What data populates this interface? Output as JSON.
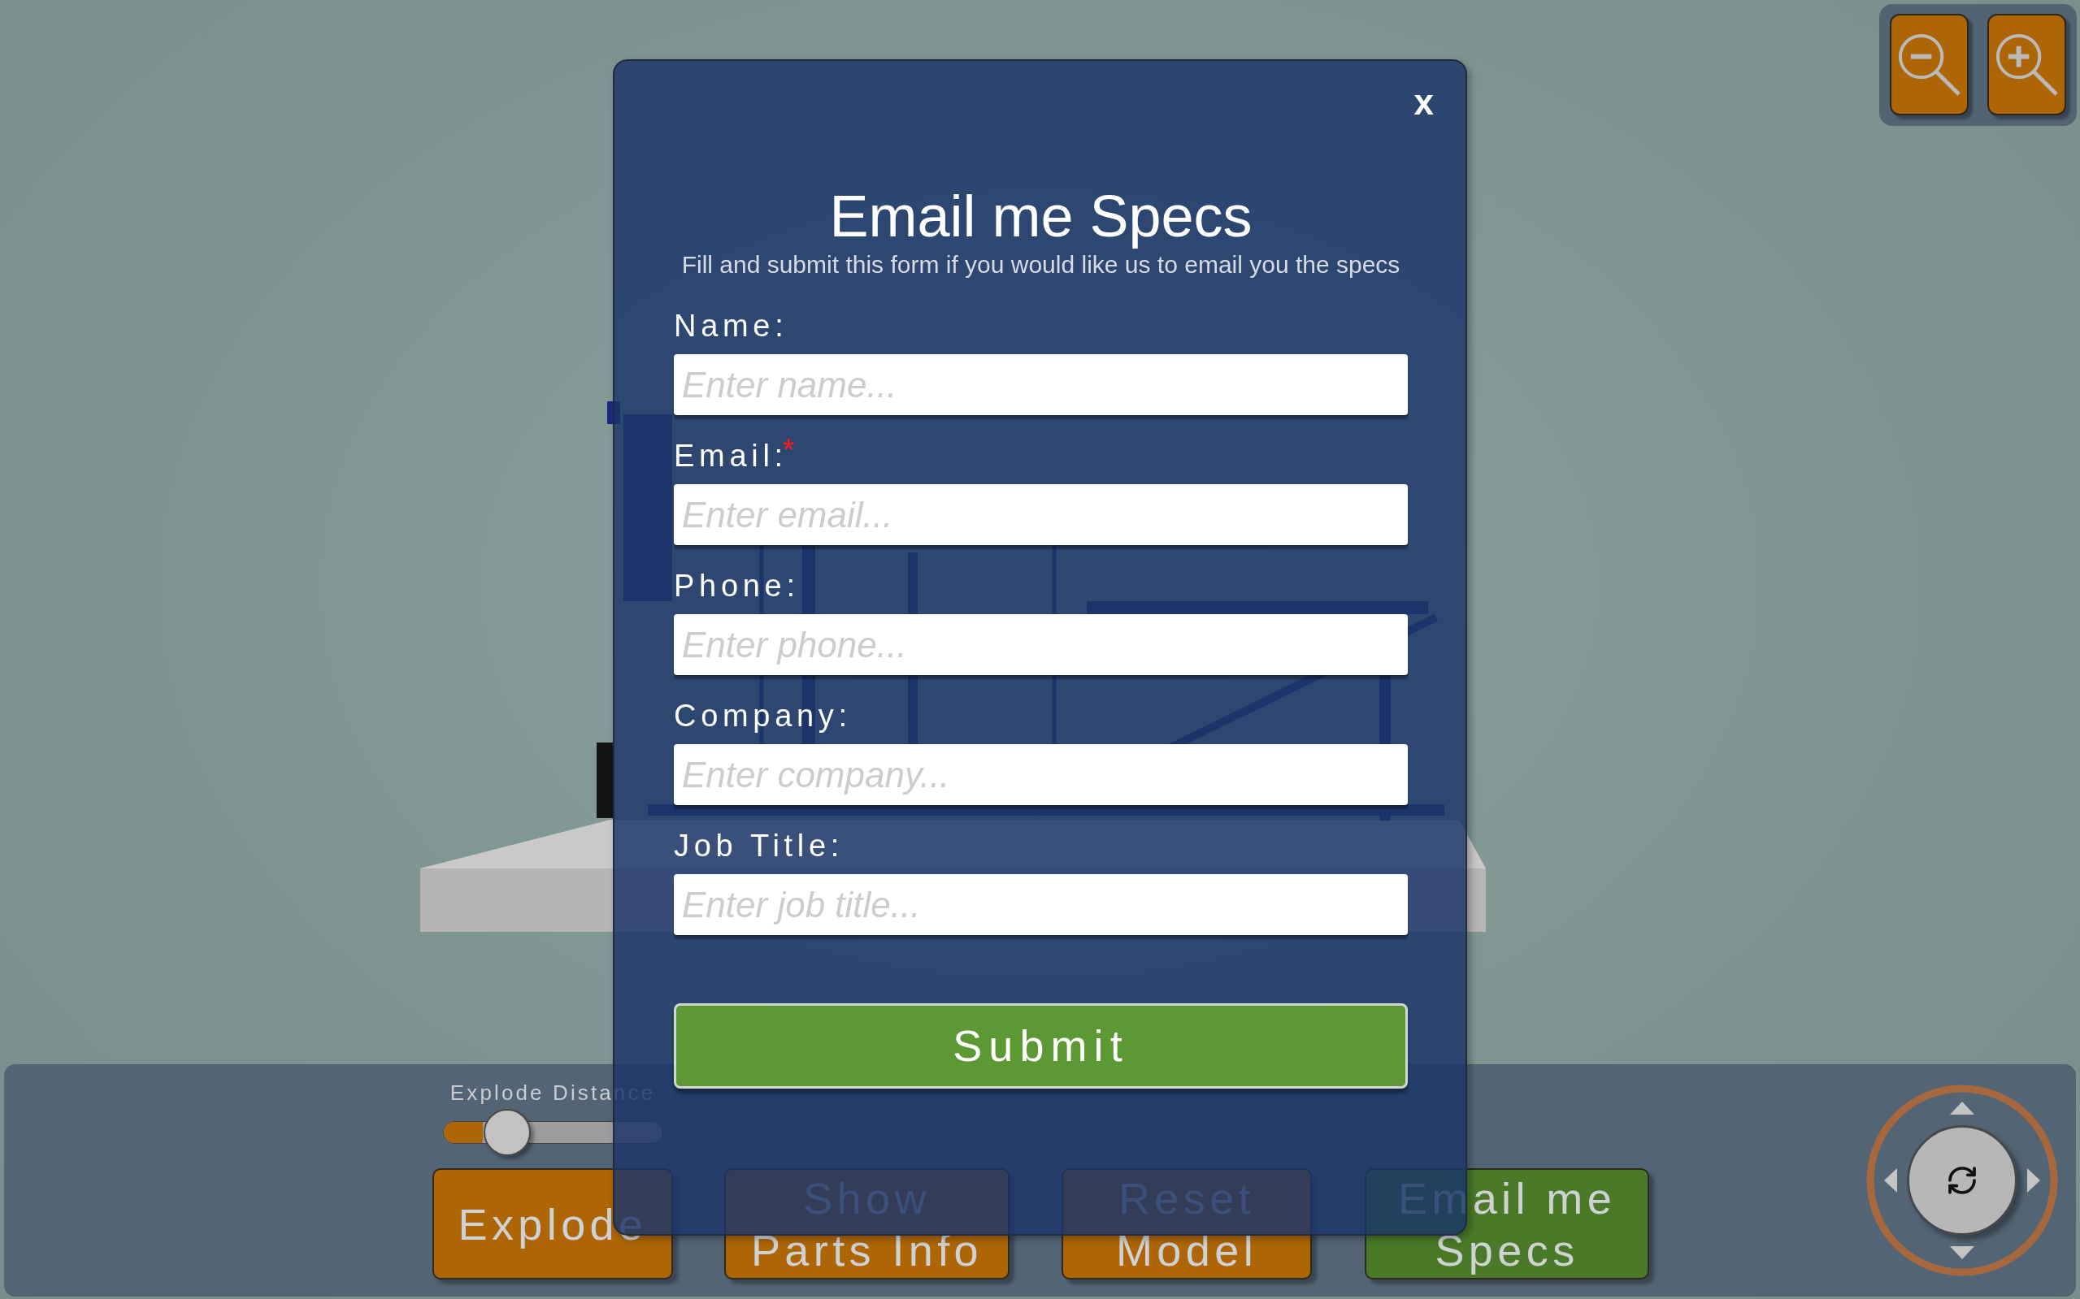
{
  "dialog": {
    "close": "x",
    "title": "Email me Specs",
    "subtitle": "Fill and submit this form if you would like us to email you the specs",
    "required_mark": "*",
    "fields": [
      {
        "label": "Name:",
        "required": false,
        "placeholder": "Enter name..."
      },
      {
        "label": "Email:",
        "required": true,
        "placeholder": "Enter email..."
      },
      {
        "label": "Phone:",
        "required": false,
        "placeholder": "Enter phone..."
      },
      {
        "label": "Company:",
        "required": false,
        "placeholder": "Enter company..."
      },
      {
        "label": "Job Title:",
        "required": false,
        "placeholder": "Enter job title..."
      }
    ],
    "submit": "Submit"
  },
  "toolbar": {
    "slider": {
      "label": "Explode Distance",
      "level": 0.29
    },
    "buttons": [
      {
        "label": "Explode",
        "color": "#ae6506"
      },
      {
        "label": "Show Parts Info",
        "color": "#ae6506"
      },
      {
        "label": "Reset Model",
        "color": "#ae6506"
      },
      {
        "label": "Email me Specs",
        "color": "#4a7a28"
      }
    ]
  }
}
